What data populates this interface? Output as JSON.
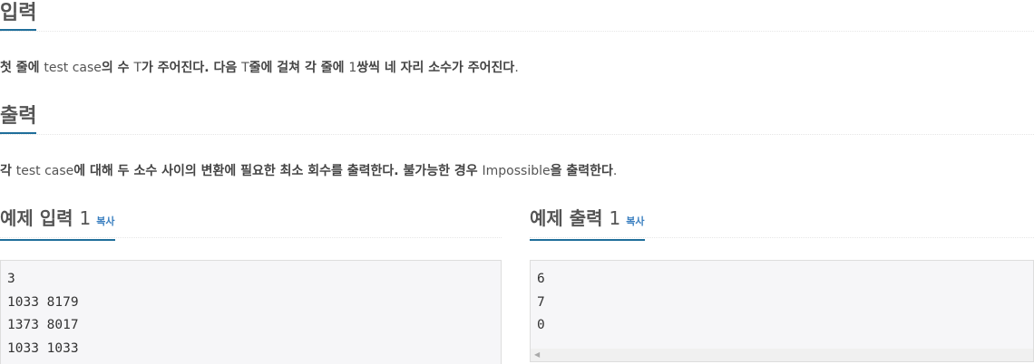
{
  "input_section": {
    "title": "입력",
    "text": [
      {
        "t": "첫 줄에 ",
        "b": true
      },
      {
        "t": "test case",
        "b": false
      },
      {
        "t": "의 수 ",
        "b": true
      },
      {
        "t": "T",
        "b": false
      },
      {
        "t": "가 주어진다. 다음 ",
        "b": true
      },
      {
        "t": "T",
        "b": false
      },
      {
        "t": "줄에 걸쳐 각 줄에 ",
        "b": true
      },
      {
        "t": "1",
        "b": false
      },
      {
        "t": "쌍씩 네 자리 소수가 주어진다",
        "b": true
      },
      {
        "t": ".",
        "b": false
      }
    ]
  },
  "output_section": {
    "title": "출력",
    "text": [
      {
        "t": "각 ",
        "b": true
      },
      {
        "t": "test case",
        "b": false
      },
      {
        "t": "에 대해 두 소수 사이의 변환에 필요한 최소 회수를 출력한다. 불가능한 경우 ",
        "b": true
      },
      {
        "t": "Impossible",
        "b": false
      },
      {
        "t": "을 출력한다",
        "b": true
      },
      {
        "t": ".",
        "b": false
      }
    ]
  },
  "sample_input": {
    "title": "예제 입력",
    "number": "1",
    "copy_label": "복사",
    "content": "3\n1033 8179\n1373 8017\n1033 1033"
  },
  "sample_output": {
    "title": "예제 출력",
    "number": "1",
    "copy_label": "복사",
    "content": "6\n7\n0"
  },
  "colors": {
    "accent": "#1f6e9a",
    "copy_link": "#3a7fc0",
    "pre_bg": "#f6f6f8"
  }
}
